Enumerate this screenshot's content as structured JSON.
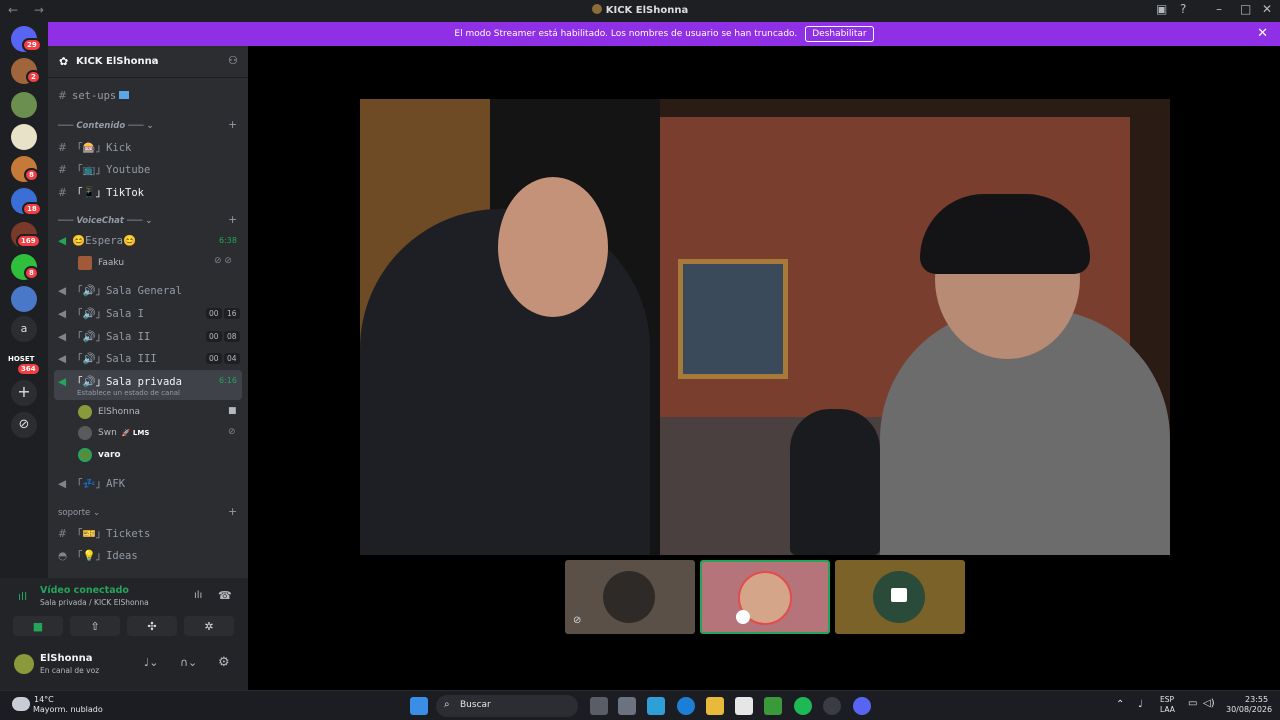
{
  "window": {
    "title": "KICK ElShonna",
    "nav_arrows": "← →"
  },
  "banner": {
    "text": "El modo Streamer está habilitado. Los nombres de usuario se han truncado.",
    "button": "Deshabilitar"
  },
  "rail": {
    "badges": [
      "29",
      "2",
      "8",
      "18",
      "169",
      "8",
      "364"
    ],
    "letter_item": "a",
    "hoset_label": "HOSET"
  },
  "server": {
    "name": "KICK ElShonna"
  },
  "channels": {
    "set_ups": "set-ups",
    "cat_contenido": "Contenido",
    "kick": "「🎰」Kick",
    "youtube": "「📺」Youtube",
    "tiktok": "「📱」TikTok",
    "cat_voice": "VoiceChat",
    "espera": "😊Espera😊",
    "espera_time": "6:38",
    "espera_user": "Faaku",
    "sala_general": "「🔊」Sala General",
    "sala_i": "「🔊」Sala I",
    "sala_i_a": "00",
    "sala_i_b": "16",
    "sala_ii": "「🔊」Sala II",
    "sala_ii_a": "00",
    "sala_ii_b": "08",
    "sala_iii": "「🔊」Sala III",
    "sala_iii_a": "00",
    "sala_iii_b": "04",
    "sala_privada": "「🔊」Sala privada",
    "sala_privada_time": "6:16",
    "sala_privada_status": "Establece un estado de canal",
    "user1": "ElShonna",
    "user2": "Swn",
    "user2_tag": "🚀 LMS",
    "user3": "varo",
    "afk": "「💤」AFK",
    "cat_soporte": "soporte",
    "tickets": "「🎫」Tickets",
    "ideas": "「💡」Ideas"
  },
  "voice_panel": {
    "status": "Vídeo conectado",
    "location": "Sala privada / KICK ElShonna"
  },
  "user_panel": {
    "name": "ElShonna",
    "status": "En canal de voz"
  },
  "taskbar": {
    "weather_temp": "14°C",
    "weather_desc": "Mayorm. nublado",
    "search_placeholder": "Buscar",
    "lang1": "ESP",
    "lang2": "LAA",
    "time": "23:55",
    "date": "30/08/2026"
  },
  "colors": {
    "banner": "#8f2fe6",
    "speaking_green": "#23a55a",
    "red_badge": "#f23f43"
  }
}
